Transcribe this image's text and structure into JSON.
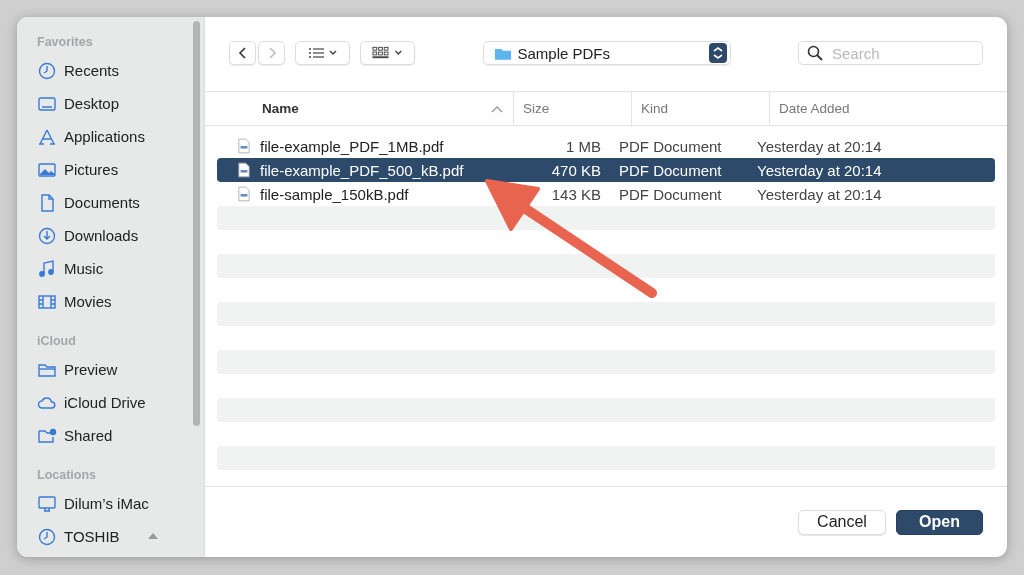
{
  "sidebar": {
    "sections": [
      {
        "title": "Favorites",
        "items": [
          {
            "label": "Recents",
            "kind": "clock"
          },
          {
            "label": "Desktop",
            "kind": "desktop"
          },
          {
            "label": "Applications",
            "kind": "apps"
          },
          {
            "label": "Pictures",
            "kind": "pictures"
          },
          {
            "label": "Documents",
            "kind": "document"
          },
          {
            "label": "Downloads",
            "kind": "download"
          },
          {
            "label": "Music",
            "kind": "music"
          },
          {
            "label": "Movies",
            "kind": "film"
          }
        ]
      },
      {
        "title": "iCloud",
        "items": [
          {
            "label": "Preview",
            "kind": "folder"
          },
          {
            "label": "iCloud Drive",
            "kind": "cloud"
          },
          {
            "label": "Shared",
            "kind": "shared"
          }
        ]
      },
      {
        "title": "Locations",
        "items": [
          {
            "label": "Dilum’s iMac",
            "kind": "computer"
          },
          {
            "label": "TOSHIB",
            "kind": "clock",
            "ejectable": true
          }
        ]
      }
    ]
  },
  "toolbar": {
    "location": "Sample PDFs",
    "search": {
      "placeholder": "Search"
    }
  },
  "table": {
    "columns": [
      {
        "label": "Name",
        "sorted": true
      },
      {
        "label": "Size",
        "sorted": false
      },
      {
        "label": "Kind",
        "sorted": false
      },
      {
        "label": "Date Added",
        "sorted": false
      }
    ],
    "rows": [
      {
        "name": "file-example_PDF_1MB.pdf",
        "size": "1 MB",
        "kind": "PDF Document",
        "date": "Yesterday at 20:14",
        "selected": false
      },
      {
        "name": "file-example_PDF_500_kB.pdf",
        "size": "470 KB",
        "kind": "PDF Document",
        "date": "Yesterday at 20:14",
        "selected": true
      },
      {
        "name": "file-sample_150kB.pdf",
        "size": "143 KB",
        "kind": "PDF Document",
        "date": "Yesterday at 20:14",
        "selected": false
      }
    ]
  },
  "buttons": {
    "cancel": "Cancel",
    "open": "Open"
  }
}
